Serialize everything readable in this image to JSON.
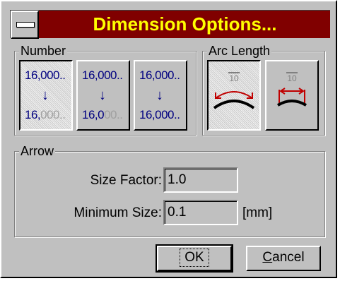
{
  "window": {
    "title": "Dimension Options..."
  },
  "number_group": {
    "title": "Number",
    "options": [
      {
        "top": "16,000..",
        "bottom_dark": "16,",
        "bottom_grey": "000..",
        "selected": true
      },
      {
        "top": "16,000..",
        "bottom_dark": "16,0",
        "bottom_grey": "00..",
        "selected": false
      },
      {
        "top": "16,000..",
        "bottom_dark": "16,000..",
        "bottom_grey": "",
        "selected": false
      }
    ],
    "arrow_glyph": "↓"
  },
  "arc_group": {
    "title": "Arc Length",
    "options": [
      {
        "label": "10",
        "selected": true
      },
      {
        "label": "10",
        "selected": false
      }
    ]
  },
  "arrow_group": {
    "title": "Arrow",
    "size_factor_label": "Size Factor:",
    "size_factor_value": "1.0",
    "minimum_size_label": "Minimum Size:",
    "minimum_size_value": "0.1",
    "unit": "[mm]"
  },
  "buttons": {
    "ok": "OK",
    "cancel_first": "C",
    "cancel_rest": "ancel"
  },
  "colors": {
    "titlebar": "#800000",
    "title_text": "#ffff00",
    "arc_red": "#c00000",
    "number_blue": "#000080"
  }
}
